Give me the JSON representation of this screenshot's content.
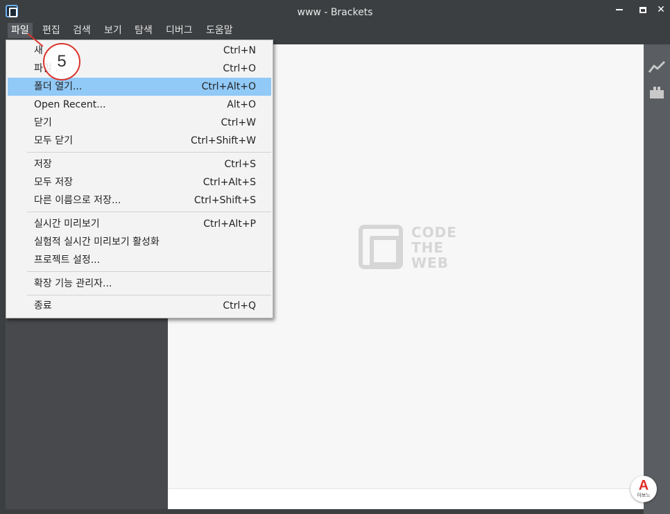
{
  "window": {
    "title": "www - Brackets",
    "controls": {
      "minimize": "minimize",
      "maximize": "maximize",
      "close": "✕"
    },
    "app_icon": "brackets-logo-icon"
  },
  "menubar": {
    "items": [
      "파일",
      "편집",
      "검색",
      "보기",
      "탐색",
      "디버그",
      "도움말"
    ],
    "active_index": 0
  },
  "file_menu": {
    "items": [
      {
        "label": "새",
        "shortcut": "Ctrl+N"
      },
      {
        "label": "파일 ...",
        "shortcut": "Ctrl+O"
      },
      {
        "label": "폴더 열기...",
        "shortcut": "Ctrl+Alt+O",
        "highlighted": true
      },
      {
        "label": "Open Recent...",
        "shortcut": "Alt+O"
      },
      {
        "label": "닫기",
        "shortcut": "Ctrl+W"
      },
      {
        "label": "모두 닫기",
        "shortcut": "Ctrl+Shift+W"
      },
      {
        "label": "저장",
        "shortcut": "Ctrl+S"
      },
      {
        "label": "모두 저장",
        "shortcut": "Ctrl+Alt+S"
      },
      {
        "label": "다른 이름으로 저장...",
        "shortcut": "Ctrl+Shift+S"
      },
      {
        "label": "실시간 미리보기",
        "shortcut": "Ctrl+Alt+P"
      },
      {
        "label": "실험적 실시간 미리보기 활성화",
        "shortcut": ""
      },
      {
        "label": "프로젝트 설정...",
        "shortcut": ""
      },
      {
        "label": "확장 기능 관리자...",
        "shortcut": ""
      },
      {
        "label": "종료",
        "shortcut": "Ctrl+Q"
      }
    ]
  },
  "watermark": {
    "line1": "CODE",
    "line2": "THE",
    "line3": "WEB"
  },
  "annotation": {
    "step": "5"
  },
  "right_toolbar": {
    "icons": [
      "live-preview-icon",
      "extension-manager-icon"
    ]
  },
  "corner_badge": {
    "letter": "A",
    "caption": "아보느"
  },
  "colors": {
    "highlight": "#91c9f7",
    "annotation": "#d9342b",
    "chrome": "#3c3f41"
  }
}
